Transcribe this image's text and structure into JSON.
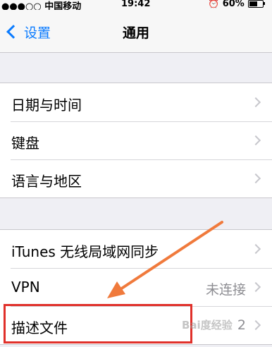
{
  "status_bar": {
    "carrier": "●●●○○ 中国移动",
    "time": "19:42",
    "battery": "60%",
    "battery_level": 0.6
  },
  "nav": {
    "back_label": "设置",
    "title": "通用"
  },
  "group1": [
    {
      "label": "日期与时间"
    },
    {
      "label": "键盘"
    },
    {
      "label": "语言与地区"
    }
  ],
  "group2": [
    {
      "label": "iTunes 无线局域网同步",
      "value": ""
    },
    {
      "label": "VPN",
      "value": "未连接"
    },
    {
      "label": "描述文件",
      "value": "2"
    }
  ],
  "watermark": "Bai度经验",
  "colors": {
    "accent": "#0a7bff",
    "annotation": "#e0302a",
    "arrow": "#f07a3c"
  }
}
